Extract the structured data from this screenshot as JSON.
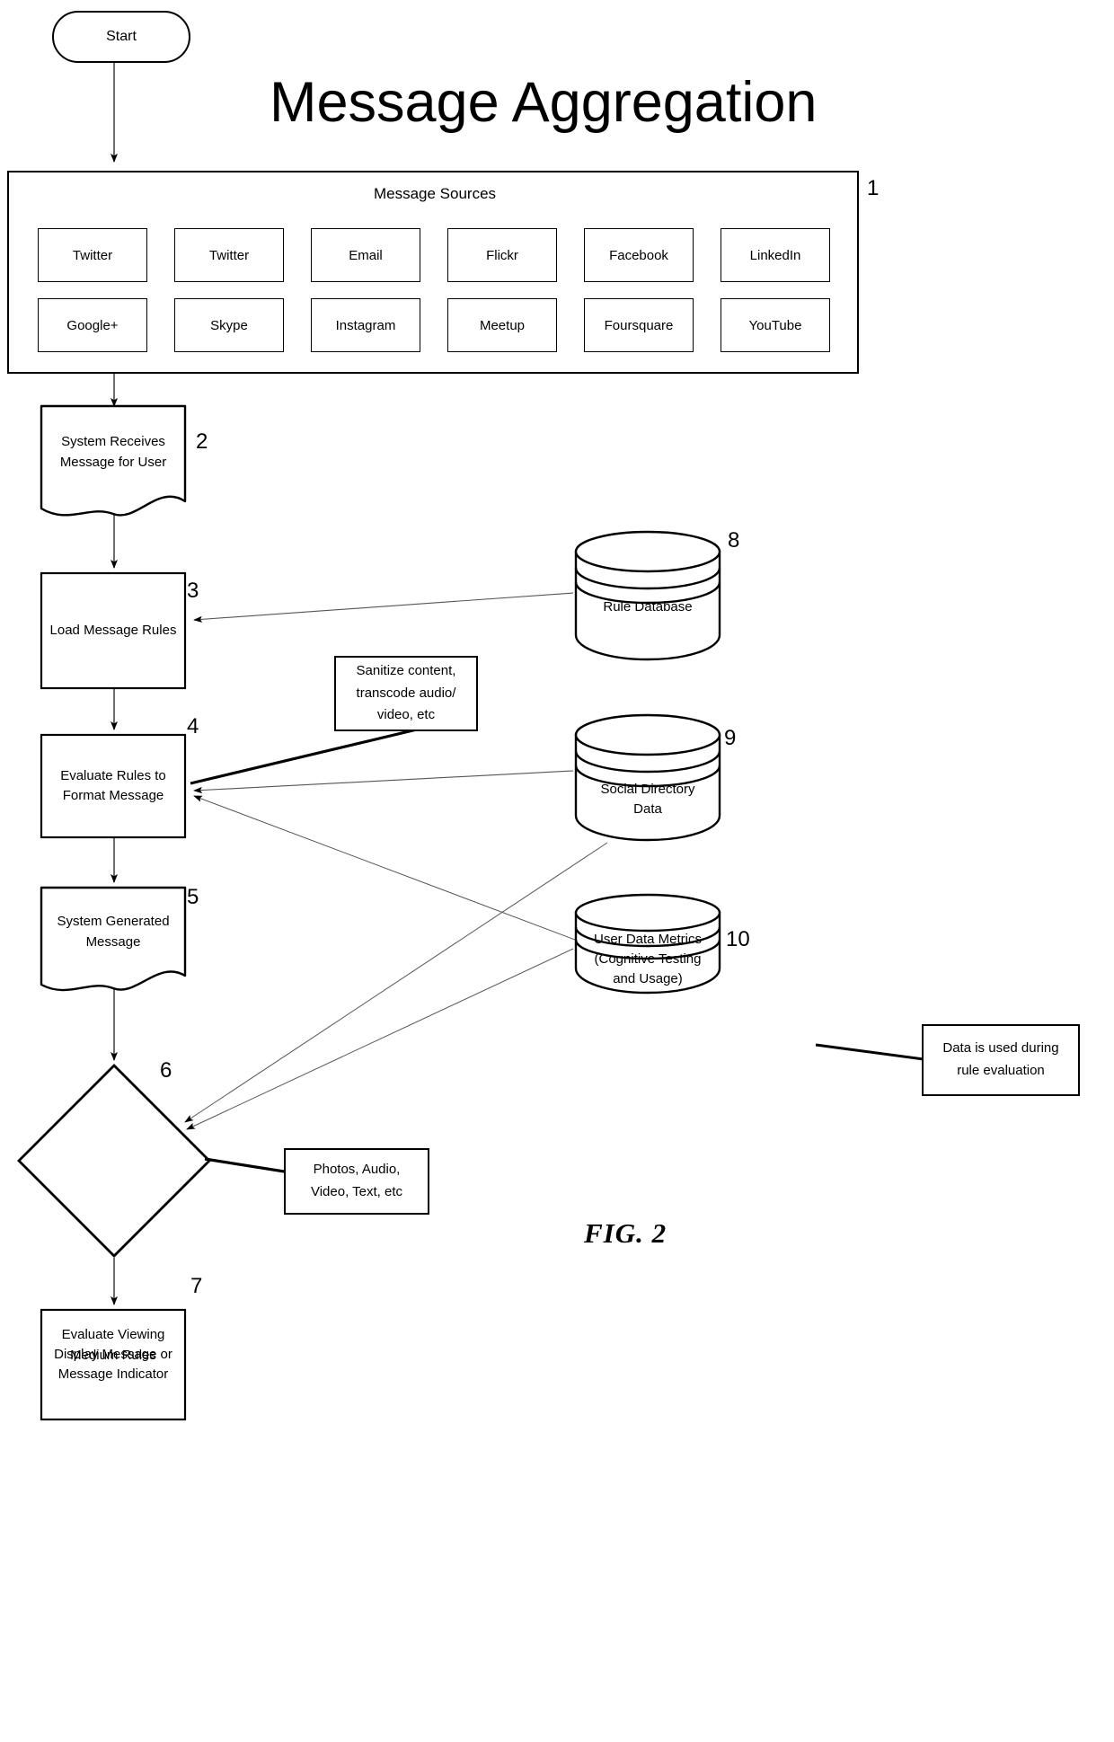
{
  "figure": {
    "title": "Message Aggregation",
    "fig_label": "FIG. 2"
  },
  "start": {
    "label": "Start"
  },
  "message_sources": {
    "title": "Message Sources",
    "ref": "1",
    "items": [
      "Twitter",
      "Twitter",
      "Email",
      "Flickr",
      "Facebook",
      "LinkedIn",
      "Google+",
      "Skype",
      "Instagram",
      "Meetup",
      "Foursquare",
      "YouTube"
    ]
  },
  "nodes": [
    {
      "id": "n2",
      "ref": "2",
      "shape": "document",
      "label": "System Receives\nMessage for User"
    },
    {
      "id": "n3",
      "ref": "3",
      "shape": "process",
      "label": "Load Message Rules"
    },
    {
      "id": "n4",
      "ref": "4",
      "shape": "process",
      "label": "Evaluate Rules to\nFormat Message"
    },
    {
      "id": "n5",
      "ref": "5",
      "shape": "document",
      "label": "System Generated\nMessage"
    },
    {
      "id": "n6",
      "ref": "6",
      "shape": "decision",
      "label": "Evaluate Viewing\nMedium Rules"
    },
    {
      "id": "n7",
      "ref": "7",
      "shape": "process",
      "label": "Display Message or\nMessage Indicator"
    }
  ],
  "datastores": [
    {
      "id": "d8",
      "ref": "8",
      "label": "Rule Database"
    },
    {
      "id": "d9",
      "ref": "9",
      "label": "Social Directory\nData"
    },
    {
      "id": "d10",
      "ref": "10",
      "label": "User Data Metrics\n(Cognitive Testing\nand Usage)"
    }
  ],
  "notes": [
    {
      "id": "note_sanitize",
      "label": "Sanitize content,\ntranscode audio/\nvideo, etc"
    },
    {
      "id": "note_rule_eval",
      "label": "Data is used during\nrule evaluation"
    },
    {
      "id": "note_media",
      "label": "Photos, Audio,\nVideo, Text, etc"
    }
  ],
  "colors": {
    "stroke": "#000000",
    "fill": "#ffffff",
    "thin_stroke": "#404040"
  }
}
